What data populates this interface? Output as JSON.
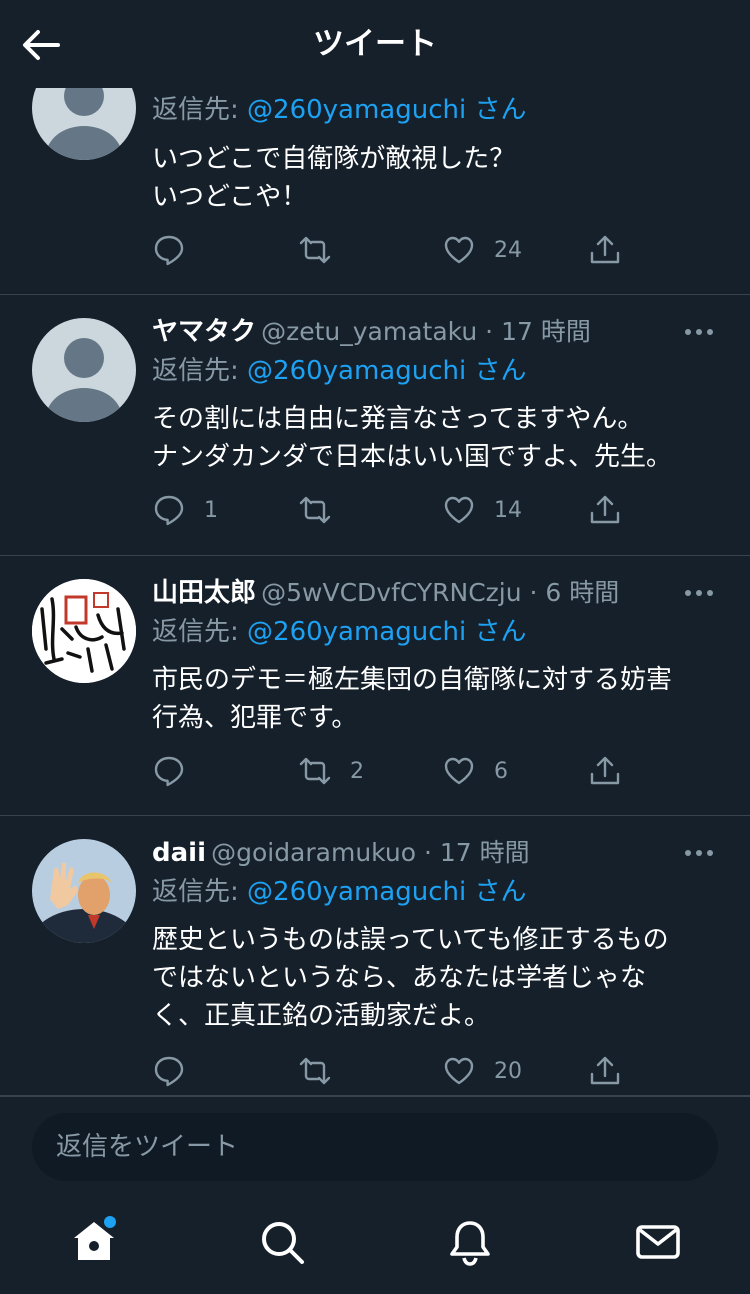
{
  "header": {
    "title": "ツイート",
    "back_icon": "arrow-left-icon"
  },
  "tweets": [
    {
      "name": "",
      "handle": "",
      "time": "",
      "reply_label": "返信先: ",
      "reply_mention": "@260yamaguchi",
      "reply_suffix": " さん",
      "text": "いつどこで自衛隊が敵視した？\nいつどこや！",
      "replies": "",
      "retweets": "",
      "likes": "24",
      "avatar": "default-avatar"
    },
    {
      "name": "ヤマタク",
      "handle": "@zetu_yamataku · 17 時間",
      "reply_label": "返信先: ",
      "reply_mention": "@260yamaguchi",
      "reply_suffix": " さん",
      "text": "その割には自由に発言なさってますやん。\nナンダカンダで日本はいい国ですよ、先生。",
      "replies": "1",
      "retweets": "",
      "likes": "14",
      "avatar": "default-avatar"
    },
    {
      "name": "山田太郎",
      "handle": "@5wVCDvfCYRNCzju · 6 時間",
      "reply_label": "返信先: ",
      "reply_mention": "@260yamaguchi",
      "reply_suffix": " さん",
      "text": "市民のデモ＝極左集団の自衛隊に対する妨害\n行為、犯罪です。",
      "replies": "",
      "retweets": "2",
      "likes": "6",
      "avatar": "stamp-avatar"
    },
    {
      "name": "daii",
      "handle": "@goidaramukuo · 17 時間",
      "reply_label": "返信先: ",
      "reply_mention": "@260yamaguchi",
      "reply_suffix": " さん",
      "text": "歴史というものは誤っていても修正するもの\nではないというなら、あなたは学者じゃな\nく、正真正銘の活動家だよ。",
      "replies": "",
      "retweets": "",
      "likes": "20",
      "avatar": "photo-avatar"
    }
  ],
  "reply_box": {
    "placeholder": "返信をツイート"
  },
  "tabs": [
    "home-icon",
    "search-icon",
    "bell-icon",
    "mail-icon"
  ],
  "colors": {
    "background": "#15202b",
    "accent": "#1da1f2",
    "muted": "#8899a6",
    "divider": "#38444d"
  }
}
